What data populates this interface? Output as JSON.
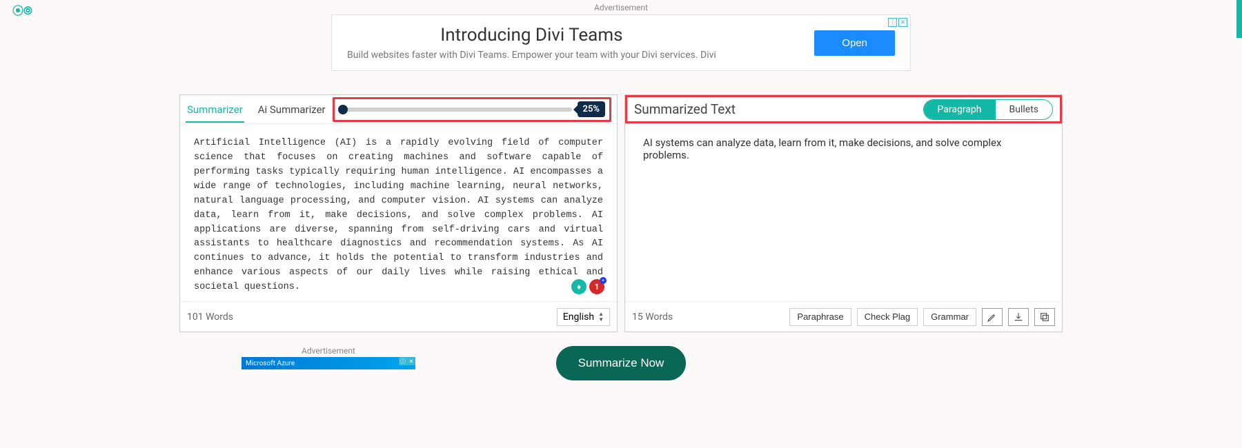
{
  "ad_top": {
    "label": "Advertisement",
    "title": "Introducing Divi Teams",
    "subtitle": "Build websites faster with Divi Teams. Empower your team with your Divi services. Divi",
    "button": "Open",
    "info_glyph": "ⓘ",
    "close_glyph": "✕"
  },
  "tabs": {
    "summarizer": "Summarizer",
    "ai_summarizer": "Ai Summarizer"
  },
  "slider": {
    "badge": "25%"
  },
  "input": {
    "text": "Artificial Intelligence (AI) is a rapidly evolving field of computer science that focuses on creating machines and software capable of performing tasks typically requiring human intelligence. AI encompasses a wide range of technologies, including machine learning, neural networks, natural language processing, and computer vision. AI systems can analyze data, learn from it, make decisions, and solve complex problems. AI applications are diverse, spanning from self-driving cars and virtual assistants to healthcare diagnostics and recommendation systems. As AI continues to advance, it holds the potential to transform industries and enhance various aspects of our daily lives while raising ethical and societal questions.",
    "word_count": "101 Words",
    "language": "English"
  },
  "output": {
    "title": "Summarized Text",
    "mode_paragraph": "Paragraph",
    "mode_bullets": "Bullets",
    "text": "AI systems can analyze data, learn from it, make decisions, and solve complex problems.",
    "word_count": "15 Words",
    "actions": {
      "paraphrase": "Paraphrase",
      "check_plag": "Check Plag",
      "grammar": "Grammar"
    }
  },
  "float": {
    "red_badge": "1"
  },
  "cta": "Summarize Now",
  "ad_bottom": {
    "label": "Advertisement",
    "text": "Microsoft Azure"
  }
}
